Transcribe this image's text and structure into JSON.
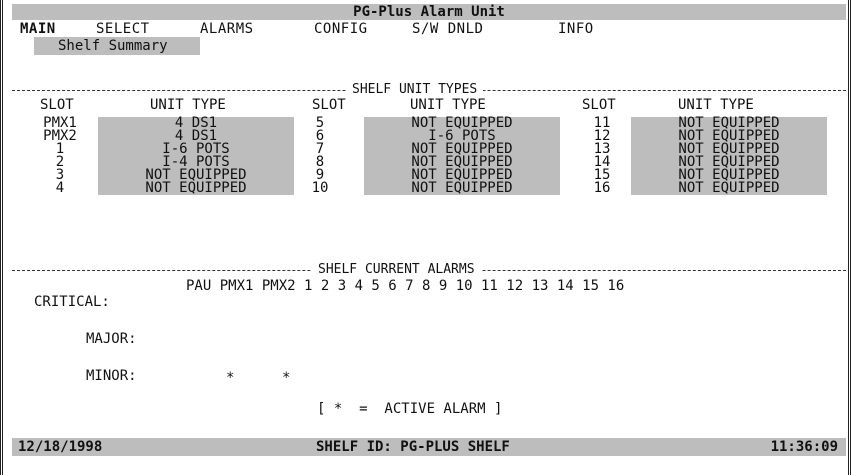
{
  "title": "PG-Plus Alarm Unit",
  "menu": {
    "main": "MAIN",
    "select": "SELECT",
    "alarms": "ALARMS",
    "config": "CONFIG",
    "swdnld": "S/W DNLD",
    "info": "INFO"
  },
  "submenu": "Shelf Summary",
  "shelf_types": {
    "title": "SHELF UNIT TYPES",
    "slot_header": "SLOT",
    "type_header": "UNIT TYPE",
    "columns": [
      {
        "slots": [
          "PMX1",
          "PMX2",
          "1",
          "2",
          "3",
          "4"
        ],
        "types": [
          "4 DS1",
          "4 DS1",
          "I-6 POTS",
          "I-4 POTS",
          "NOT EQUIPPED",
          "NOT EQUIPPED"
        ]
      },
      {
        "slots": [
          "5",
          "6",
          "7",
          "8",
          "9",
          "10"
        ],
        "types": [
          "NOT EQUIPPED",
          "I-6 POTS",
          "NOT EQUIPPED",
          "NOT EQUIPPED",
          "NOT EQUIPPED",
          "NOT EQUIPPED"
        ]
      },
      {
        "slots": [
          "11",
          "12",
          "13",
          "14",
          "15",
          "16"
        ],
        "types": [
          "NOT EQUIPPED",
          "NOT EQUIPPED",
          "NOT EQUIPPED",
          "NOT EQUIPPED",
          "NOT EQUIPPED",
          "NOT EQUIPPED"
        ]
      }
    ]
  },
  "alarms": {
    "title": "SHELF CURRENT ALARMS",
    "header": "PAU PMX1 PMX2 1 2 3 4 5 6 7 8 9 10 11 12 13 14 15 16",
    "critical": "CRITICAL:",
    "major": "MAJOR:",
    "minor": "MINOR:",
    "star": "*",
    "legend": "[ *  =  ACTIVE ALARM ]"
  },
  "status": {
    "date": "12/18/1998",
    "shelf_id": "SHELF ID: PG-PLUS SHELF",
    "time": "11:36:09"
  }
}
